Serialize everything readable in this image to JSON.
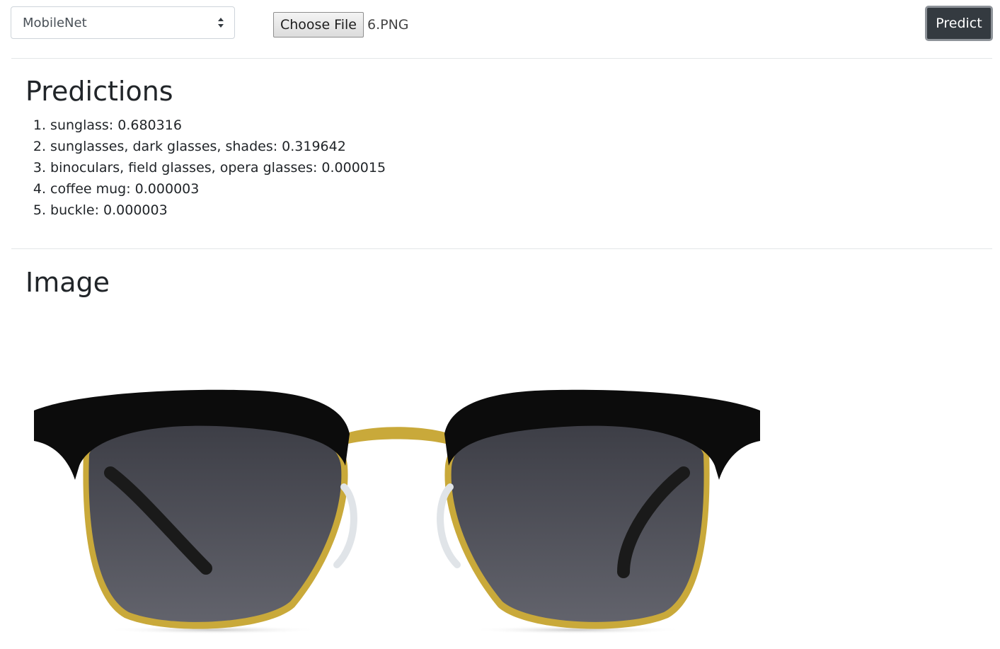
{
  "toolbar": {
    "model_select_value": "MobileNet",
    "choose_file_label": "Choose File",
    "file_name": "6.PNG",
    "predict_label": "Predict"
  },
  "predictions": {
    "title": "Predictions",
    "items": [
      {
        "rank": "1.",
        "text": "sunglass: 0.680316"
      },
      {
        "rank": "2.",
        "text": "sunglasses, dark glasses, shades: 0.319642"
      },
      {
        "rank": "3.",
        "text": "binoculars, field glasses, opera glasses: 0.000015"
      },
      {
        "rank": "4.",
        "text": "coffee mug: 0.000003"
      },
      {
        "rank": "5.",
        "text": "buckle: 0.000003"
      }
    ]
  },
  "image_section": {
    "title": "Image"
  },
  "icons": {
    "select_caret": "up-down-caret-icon"
  },
  "colors": {
    "predict_button_bg": "#343a40",
    "divider": "#e3e6e8"
  }
}
